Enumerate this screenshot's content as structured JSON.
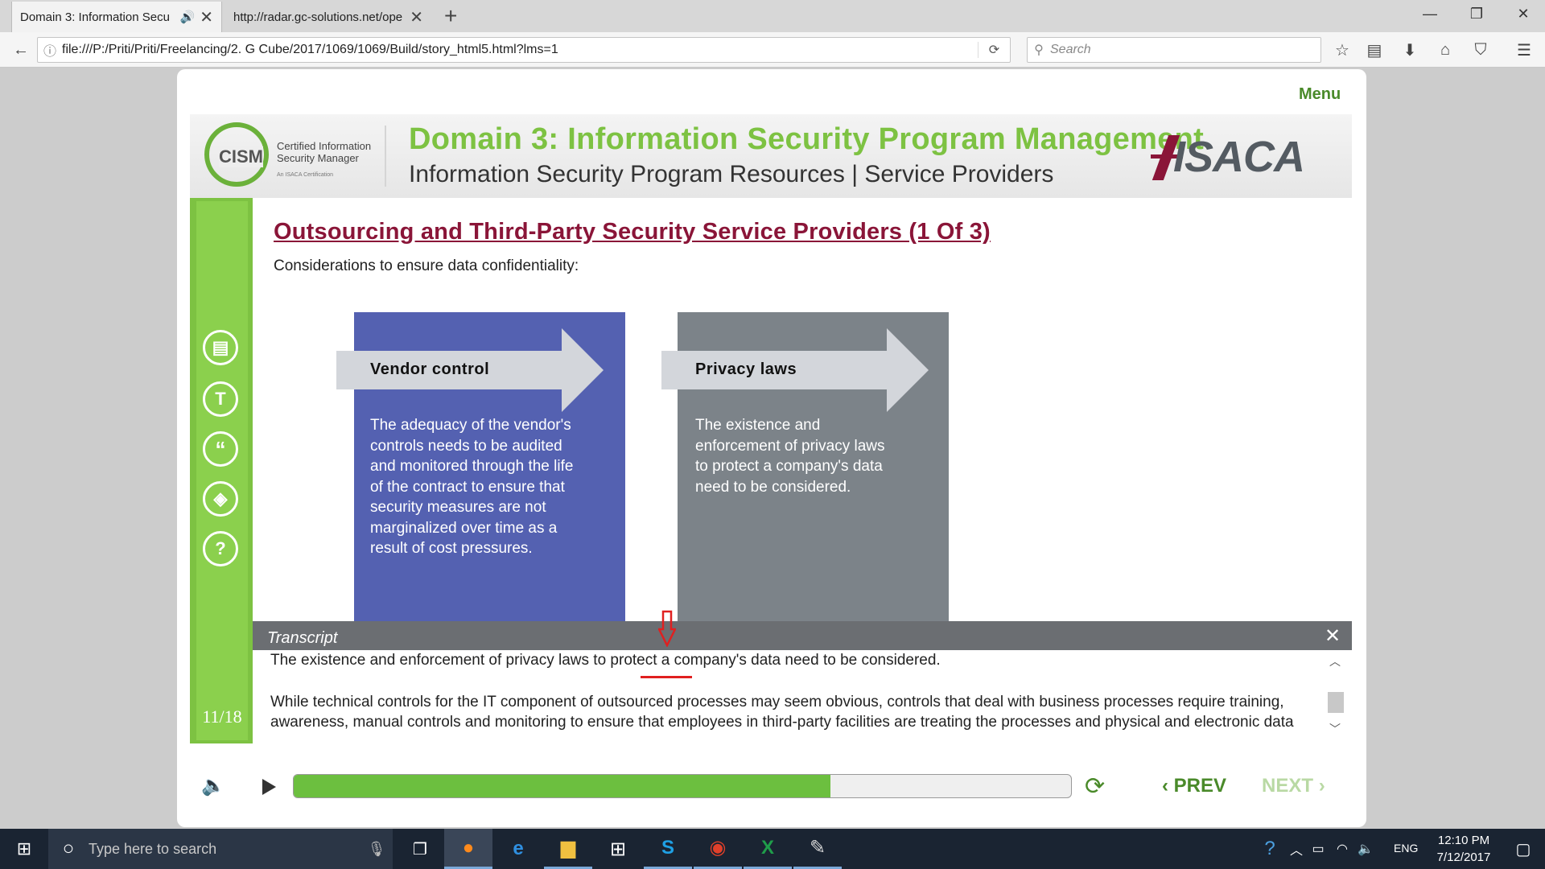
{
  "browser": {
    "tabs": [
      {
        "label": "Domain 3: Information Secu"
      },
      {
        "label": "http://radar.gc-solutions.net/ope"
      }
    ],
    "new_tab_symbol": "+",
    "url": "file:///P:/Priti/Priti/Freelancing/2. G Cube/2017/1069/1069/Build/story_html5.html?lms=1",
    "search_placeholder": "Search"
  },
  "course": {
    "menu_label": "Menu",
    "cism_logo": {
      "text": "CISM",
      "line1": "Certified Information",
      "line2": "Security Manager",
      "line3": "An ISACA Certification"
    },
    "header_title": "Domain 3: Information Security Program Management",
    "header_subtitle": "Information Security Program Resources | Service Providers",
    "isaca_logo": "ISACA",
    "page_count": "11/18",
    "slide_title": "Outsourcing and Third-Party Security Service Providers (1 Of 3)",
    "slide_subtitle": "Considerations to ensure data confidentiality:",
    "cards": [
      {
        "label": "Vendor control",
        "color": "#5461b1",
        "lines": [
          "The adequacy of the vendor's",
          "controls needs to be audited",
          "and monitored through the life",
          "of the contract to ensure that",
          "security measures are not",
          "marginalized over time as a",
          "result of cost pressures."
        ]
      },
      {
        "label": "Privacy laws",
        "color": "#7c8389",
        "lines": [
          "The existence and",
          "enforcement of privacy laws",
          "to protect a company's data",
          "need to be considered."
        ]
      }
    ],
    "transcript": {
      "label": "Transcript",
      "close_symbol": "✕",
      "line1": "The existence and enforcement of privacy laws to protect a company's data need to be considered.",
      "line2": "While technical controls for the IT component of outsourced processes may seem obvious, controls that deal with business processes require training,",
      "line3": "awareness, manual controls and monitoring to ensure that employees in third-party facilities are treating the processes and physical and electronic data"
    },
    "controls": {
      "progress_fraction": 0.69,
      "prev_label": "PREV",
      "next_label": "NEXT"
    },
    "sidebar_icons": [
      "document-icon",
      "text-icon",
      "quote-icon",
      "layers-icon",
      "help-icon"
    ],
    "accent_green": "#7dc242",
    "title_color": "#8a1538"
  },
  "taskbar": {
    "search_placeholder": "Type here to search",
    "language": "ENG",
    "time": "12:10 PM",
    "date": "7/12/2017"
  }
}
